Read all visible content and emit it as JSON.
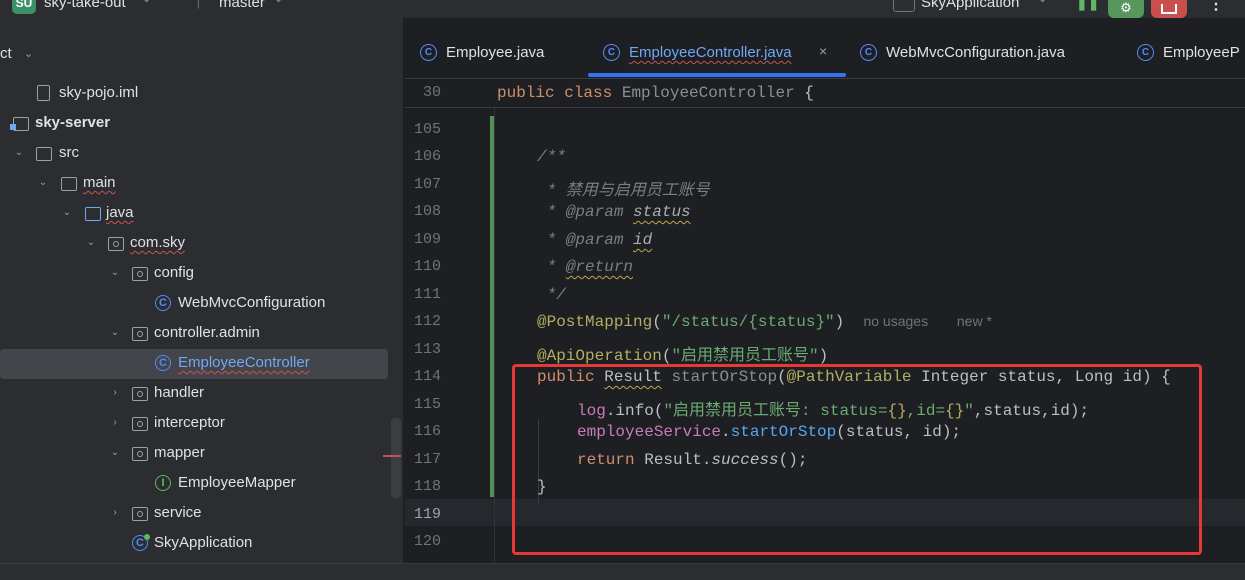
{
  "topbar": {
    "project_badge": "SU",
    "project_name": "sky-take-out",
    "branch_name": "master",
    "run_config": "SkyApplication"
  },
  "sidebar": {
    "title": "ct",
    "tree": [
      {
        "label": "sky-pojo.iml",
        "icon": "file-icon",
        "arrow": ""
      },
      {
        "label": "sky-server",
        "icon": "module-icon",
        "arrow": ""
      },
      {
        "label": "src",
        "icon": "folder-icon",
        "arrow": "expanded"
      },
      {
        "label": "main",
        "icon": "folder-icon",
        "arrow": "expanded"
      },
      {
        "label": "java",
        "icon": "source-folder-icon",
        "arrow": "expanded"
      },
      {
        "label": "com.sky",
        "icon": "package-icon",
        "arrow": "expanded"
      },
      {
        "label": "config",
        "icon": "package-icon",
        "arrow": "expanded"
      },
      {
        "label": "WebMvcConfiguration",
        "icon": "class-icon",
        "arrow": ""
      },
      {
        "label": "controller.admin",
        "icon": "package-icon",
        "arrow": "expanded"
      },
      {
        "label": "EmployeeController",
        "icon": "class-icon",
        "arrow": "",
        "selected": true
      },
      {
        "label": "handler",
        "icon": "package-icon",
        "arrow": "collapsed"
      },
      {
        "label": "interceptor",
        "icon": "package-icon",
        "arrow": "collapsed"
      },
      {
        "label": "mapper",
        "icon": "package-icon",
        "arrow": "expanded"
      },
      {
        "label": "EmployeeMapper",
        "icon": "interface-icon",
        "arrow": ""
      },
      {
        "label": "service",
        "icon": "package-icon",
        "arrow": "collapsed"
      },
      {
        "label": "SkyApplication",
        "icon": "application-icon",
        "arrow": ""
      }
    ]
  },
  "tabs": [
    {
      "label": "Employee.java",
      "icon": "C"
    },
    {
      "label": "EmployeeController.java",
      "icon": "C",
      "active": true,
      "close": "×"
    },
    {
      "label": "WebMvcConfiguration.java",
      "icon": "C"
    },
    {
      "label": "EmployeeP",
      "icon": "C"
    }
  ],
  "editor": {
    "sticky_line_number": "30",
    "sticky": {
      "kw1": "public",
      "kw2": "class",
      "cls": "EmployeeController",
      "brace": "{"
    },
    "line_numbers": [
      "105",
      "106",
      "107",
      "108",
      "109",
      "110",
      "111",
      "112",
      "113",
      "114",
      "115",
      "116",
      "117",
      "118",
      "119",
      "120"
    ],
    "current_line": "119",
    "code": {
      "l106": "/**",
      "l107": " * 禁用与启用员工账号",
      "l108_tag": "@param",
      "l108_name": "status",
      "l109_tag": "@param",
      "l109_name": "id",
      "l110_tag": "@return",
      "l111": " */",
      "l112_ann": "@PostMapping",
      "l112_open": "(",
      "l112_str": "\"/status/{status}\"",
      "l112_close": ")",
      "l112_hint1": "no usages",
      "l112_hint2": "new *",
      "l113_ann": "@ApiOperation",
      "l113_open": "(",
      "l113_str": "\"启用禁用员工账号\"",
      "l113_close": ")",
      "l114_kw": "public",
      "l114_type": "Result",
      "l114_name": "startOrStop",
      "l114_open": "(",
      "l114_ann": "@PathVariable",
      "l114_rest": " Integer status, Long id) {",
      "l115_field": "log",
      "l115_dot": ".",
      "l115_m": "info",
      "l115_open": "(",
      "l115_str1": "\"启用禁用员工账号: status=",
      "l115_ph1": "{}",
      "l115_str2": ",id=",
      "l115_ph2": "{}",
      "l115_str3": "\"",
      "l115_rest": ",status,id);",
      "l116_field": "employeeService",
      "l116_dot": ".",
      "l116_m": "startOrStop",
      "l116_rest": "(status, id);",
      "l117_kw": "return",
      "l117_cls": " Result.",
      "l117_m": "success",
      "l117_rest": "();",
      "l118": "}"
    }
  },
  "colors": {
    "highlight_box": "#e53935",
    "accent": "#3574f0",
    "vcs_added": "#549159"
  }
}
